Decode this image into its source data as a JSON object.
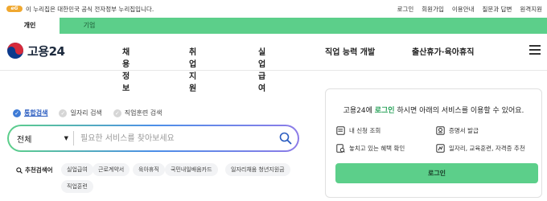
{
  "topbar": {
    "notice": "이 누리집은 대한민국 공식 전자정부 누리집입니다.",
    "links": [
      "로그인",
      "회원가입",
      "이용안내",
      "질문과 답변",
      "원격지원"
    ]
  },
  "user_tabs": [
    {
      "label": "개인",
      "active": true
    },
    {
      "label": "기업",
      "active": false
    }
  ],
  "header": {
    "logo_text": "고용24",
    "nav": [
      "채용정보",
      "취업지원",
      "실업급여",
      "직업 능력 개발",
      "출산휴가·육아휴직"
    ]
  },
  "search": {
    "scopes": [
      {
        "label": "통합검색",
        "selected": true
      },
      {
        "label": "일자리 검색",
        "selected": false
      },
      {
        "label": "직업훈련 검색",
        "selected": false
      }
    ],
    "category": "전체",
    "placeholder": "필요한 서비스를 찾아보세요",
    "value": ""
  },
  "recommended": {
    "title": "추천검색어",
    "keywords": [
      "실업급여",
      "근로계약서",
      "육아휴직",
      "국민내일배움카드",
      "일자리채움 청년지원금",
      "직업훈련"
    ]
  },
  "login_card": {
    "title_prefix": "고용24에 ",
    "title_highlight": "로그인",
    "title_suffix": " 하시면 아래의 서비스를 이용할 수 있어요.",
    "services": [
      {
        "label": "내 신청 조회",
        "icon": "application-list-icon"
      },
      {
        "label": "증명서 발급",
        "icon": "certificate-icon"
      },
      {
        "label": "놓치고 있는 혜택 확인",
        "icon": "benefit-check-icon"
      },
      {
        "label": "일자리, 교육훈련, 자격증 추천",
        "icon": "recommend-icon"
      }
    ],
    "button_label": "로그인"
  },
  "colors": {
    "brand_green": "#5ccf8a",
    "link_blue": "#2a5cc0",
    "highlight_green": "#2ba35b"
  }
}
